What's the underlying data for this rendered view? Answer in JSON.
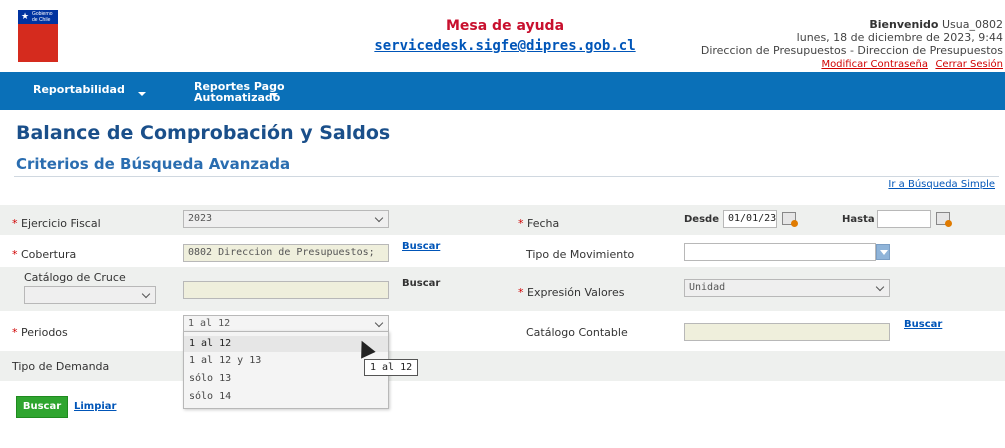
{
  "header": {
    "logo_text_1": "Gobierno",
    "logo_text_2": "de Chile",
    "help_title": "Mesa de ayuda",
    "help_email": "servicedesk.sigfe@dipres.gob.cl",
    "welcome_label": "Bienvenido",
    "user": "Usua_0802",
    "datetime": "lunes, 18 de diciembre de 2023, 9:44",
    "org": "Direccion de Presupuestos - Direccion de Presupuestos",
    "change_password": "Modificar Contraseña",
    "logout": "Cerrar Sesión"
  },
  "nav": {
    "items": [
      {
        "label_1": "Reportabilidad",
        "label_2": ""
      },
      {
        "label_1": "Reportes Pago",
        "label_2": "Automatizado"
      }
    ]
  },
  "page": {
    "title": "Balance de Comprobación y Saldos",
    "subtitle": "Criterios de Búsqueda Avanzada",
    "simple_search_link": "Ir a Búsqueda Simple"
  },
  "form": {
    "required_mark": "*",
    "ejercicio_label": "Ejercicio Fiscal",
    "ejercicio_value": "2023",
    "fecha_label": "Fecha",
    "desde_label": "Desde",
    "desde_value": "01/01/23",
    "hasta_label": "Hasta",
    "hasta_value": "",
    "cobertura_label": "Cobertura",
    "cobertura_value": "0802 Direccion de Presupuestos;",
    "cobertura_buscar": "Buscar",
    "tipo_mov_label": "Tipo de Movimiento",
    "tipo_mov_value": "",
    "catalogo_cruce_label": "Catálogo de Cruce",
    "catalogo_cruce_value": "",
    "catalogo_cruce_buscar": "Buscar",
    "expresion_label": "Expresión Valores",
    "expresion_value": "Unidad",
    "periodos_label": "Periodos",
    "periodos_value": "1 al 12",
    "periodos_options": [
      "1 al 12",
      "1 al 12 y 13",
      "sólo 13",
      "sólo 14"
    ],
    "catalogo_contable_label": "Catálogo Contable",
    "catalogo_contable_buscar": "Buscar",
    "tipo_demanda_label": "Tipo de Demanda",
    "tooltip": "1 al 12"
  },
  "actions": {
    "search_button": "Buscar",
    "clear_link": "Limpiar"
  },
  "colors": {
    "nav_bg": "#0a70b8",
    "title": "#1a4f8a",
    "required": "#d00000",
    "search_button": "#2fa52f"
  }
}
